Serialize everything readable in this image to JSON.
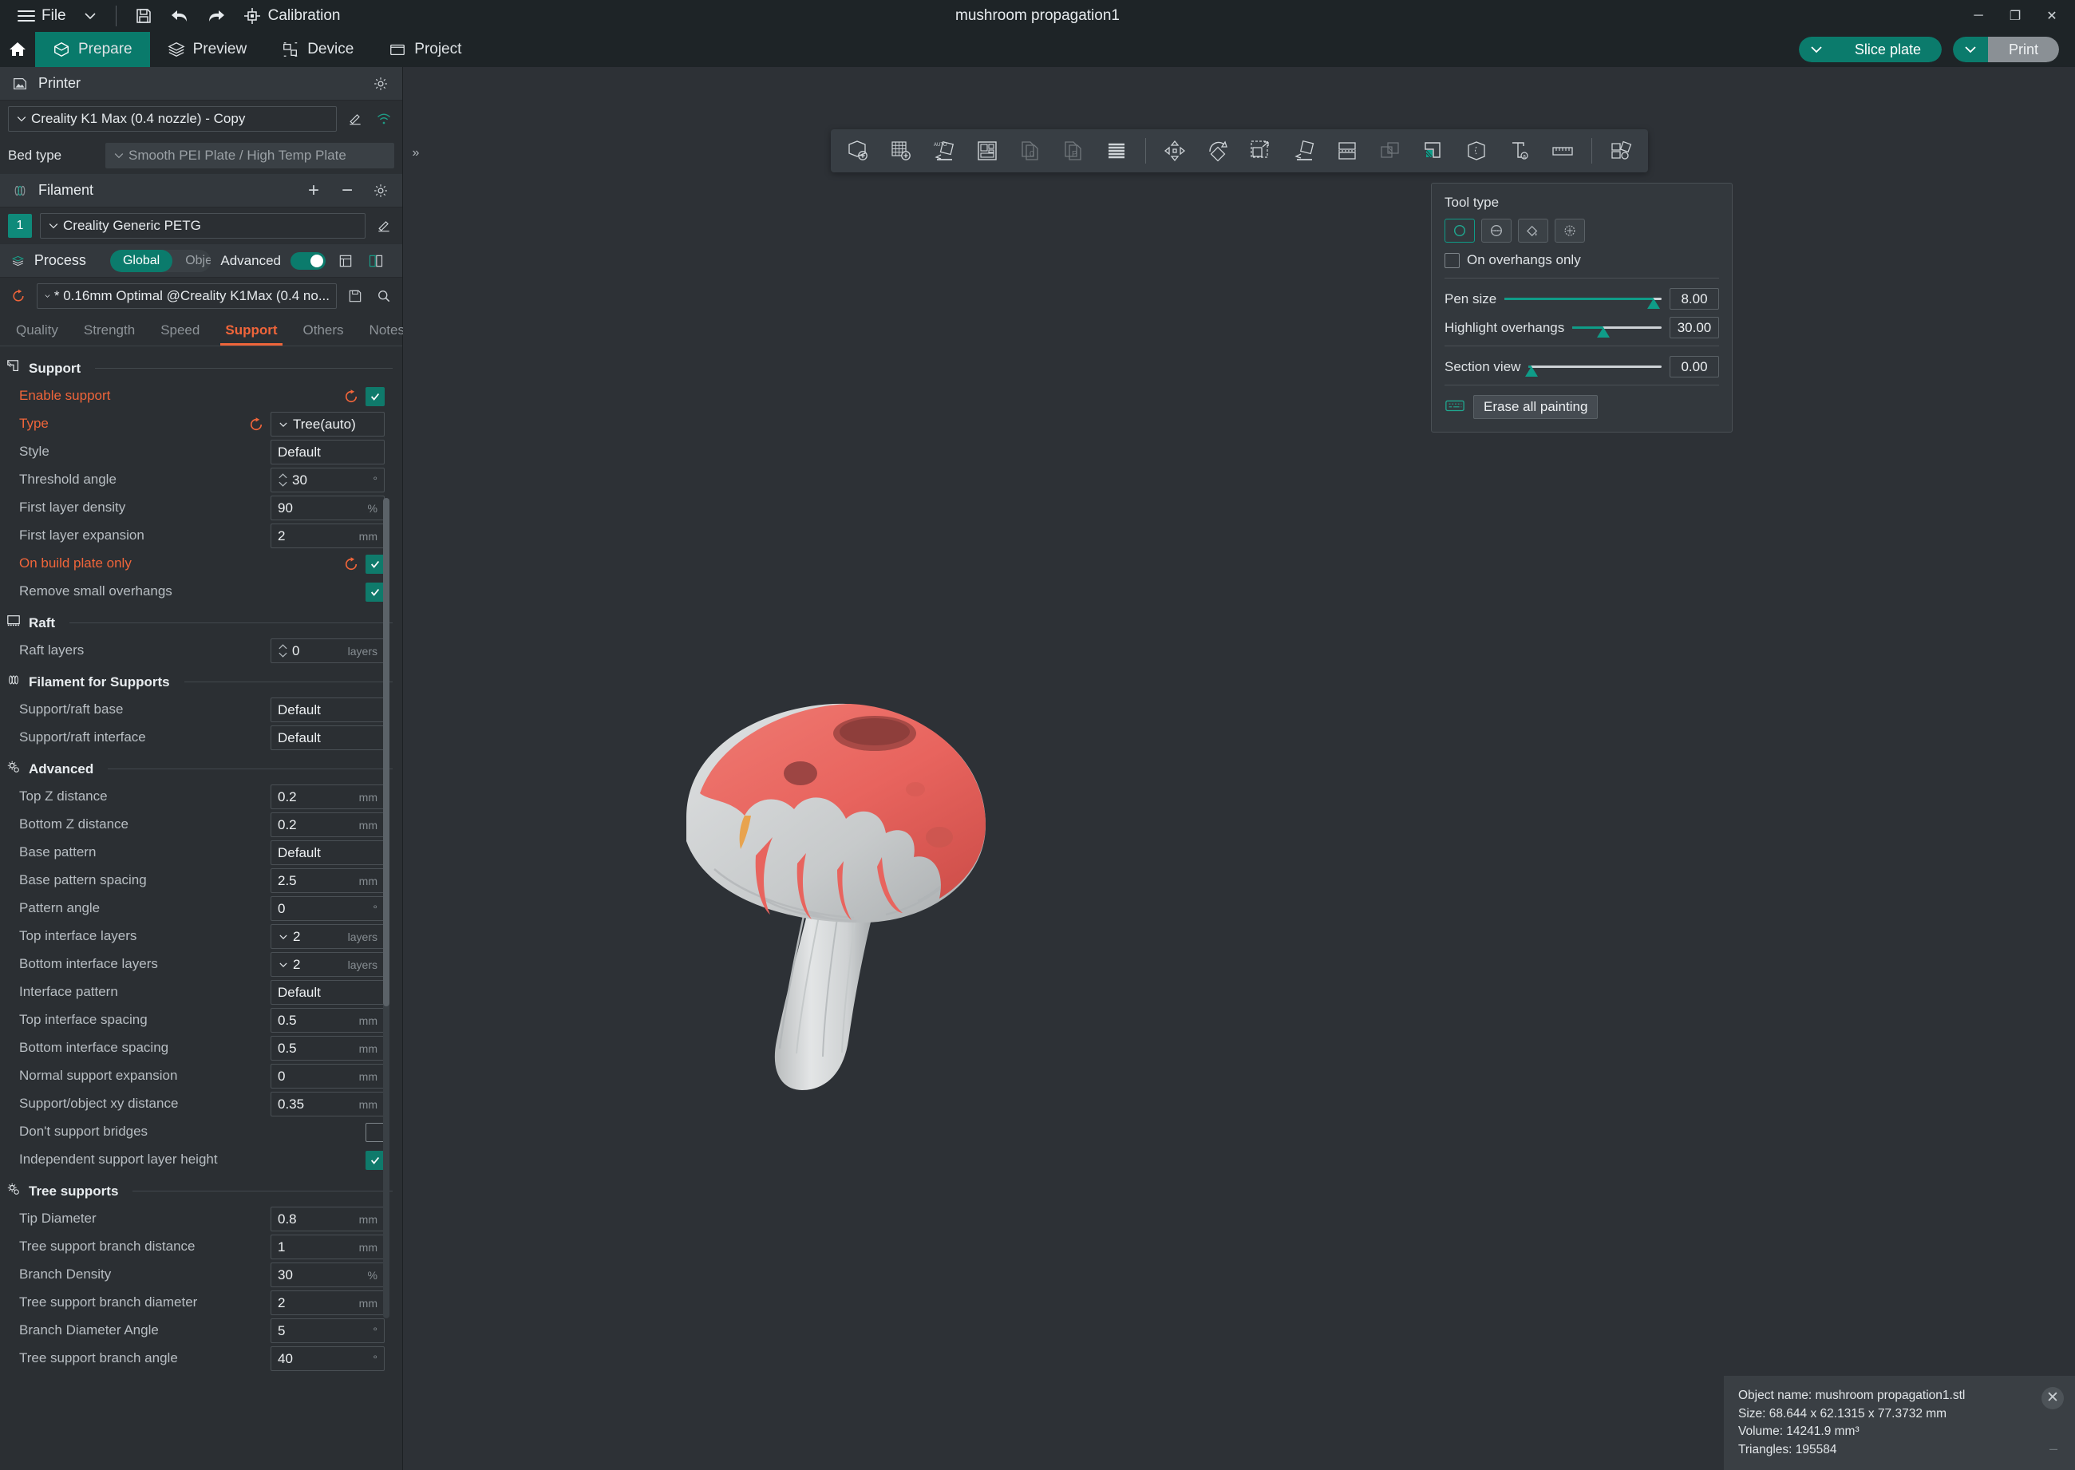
{
  "titlebar": {
    "file_label": "File",
    "calibration_label": "Calibration",
    "window_title": "mushroom propagation1",
    "minimize": "─",
    "maximize": "❐",
    "close": "✕"
  },
  "nav": {
    "tabs": [
      {
        "label": "Prepare",
        "icon": "cube-icon",
        "active": true
      },
      {
        "label": "Preview",
        "icon": "layers-icon",
        "active": false
      },
      {
        "label": "Device",
        "icon": "device-icon",
        "active": false
      },
      {
        "label": "Project",
        "icon": "project-icon",
        "active": false
      }
    ],
    "slice_label": "Slice plate",
    "print_label": "Print"
  },
  "printer": {
    "section_label": "Printer",
    "preset": "Creality K1 Max (0.4 nozzle) - Copy",
    "bed_type_label": "Bed type",
    "bed_type_value": "Smooth PEI Plate / High Temp Plate"
  },
  "filament": {
    "section_label": "Filament",
    "index": "1",
    "preset": "Creality Generic PETG",
    "add": "+",
    "remove": "−"
  },
  "process": {
    "section_label": "Process",
    "global_label": "Global",
    "objects_label": "Objects",
    "advanced_label": "Advanced",
    "preset": "* 0.16mm Optimal @Creality K1Max (0.4 no...",
    "tabs": [
      {
        "label": "Quality",
        "active": false
      },
      {
        "label": "Strength",
        "active": false
      },
      {
        "label": "Speed",
        "active": false
      },
      {
        "label": "Support",
        "active": true
      },
      {
        "label": "Others",
        "active": false
      },
      {
        "label": "Notes",
        "active": false
      }
    ]
  },
  "settings": {
    "sections": [
      {
        "title": "Support",
        "icon": "support-icon",
        "rows": [
          {
            "name": "Enable support",
            "highlight": true,
            "reset": true,
            "type": "check",
            "checked": true
          },
          {
            "name": "Type",
            "highlight": true,
            "reset": true,
            "type": "combo",
            "value": "Tree(auto)"
          },
          {
            "name": "Style",
            "type": "text",
            "value": "Default"
          },
          {
            "name": "Threshold angle",
            "type": "spin",
            "value": "30",
            "unit": "°"
          },
          {
            "name": "First layer density",
            "type": "text",
            "value": "90",
            "unit": "%"
          },
          {
            "name": "First layer expansion",
            "type": "text",
            "value": "2",
            "unit": "mm"
          },
          {
            "name": "On build plate only",
            "highlight": true,
            "reset": true,
            "type": "check",
            "checked": true
          },
          {
            "name": "Remove small overhangs",
            "type": "check",
            "checked": true
          }
        ]
      },
      {
        "title": "Raft",
        "icon": "raft-icon",
        "rows": [
          {
            "name": "Raft layers",
            "type": "spin",
            "value": "0",
            "unit": "layers"
          }
        ]
      },
      {
        "title": "Filament for Supports",
        "icon": "filament-icon",
        "rows": [
          {
            "name": "Support/raft base",
            "type": "text",
            "value": "Default"
          },
          {
            "name": "Support/raft interface",
            "type": "text",
            "value": "Default"
          }
        ]
      },
      {
        "title": "Advanced",
        "icon": "gear-icon",
        "rows": [
          {
            "name": "Top Z distance",
            "type": "text",
            "value": "0.2",
            "unit": "mm"
          },
          {
            "name": "Bottom Z distance",
            "type": "text",
            "value": "0.2",
            "unit": "mm"
          },
          {
            "name": "Base pattern",
            "type": "text",
            "value": "Default"
          },
          {
            "name": "Base pattern spacing",
            "type": "text",
            "value": "2.5",
            "unit": "mm"
          },
          {
            "name": "Pattern angle",
            "type": "text",
            "value": "0",
            "unit": "°"
          },
          {
            "name": "Top interface layers",
            "type": "combo-num",
            "value": "2",
            "unit": "layers"
          },
          {
            "name": "Bottom interface layers",
            "type": "combo-num",
            "value": "2",
            "unit": "layers"
          },
          {
            "name": "Interface pattern",
            "type": "text",
            "value": "Default"
          },
          {
            "name": "Top interface spacing",
            "type": "text",
            "value": "0.5",
            "unit": "mm"
          },
          {
            "name": "Bottom interface spacing",
            "type": "text",
            "value": "0.5",
            "unit": "mm"
          },
          {
            "name": "Normal support expansion",
            "type": "text",
            "value": "0",
            "unit": "mm"
          },
          {
            "name": "Support/object xy distance",
            "type": "text",
            "value": "0.35",
            "unit": "mm"
          },
          {
            "name": "Don't support bridges",
            "type": "check",
            "checked": false
          },
          {
            "name": "Independent support layer height",
            "type": "check",
            "checked": true
          }
        ]
      },
      {
        "title": "Tree supports",
        "icon": "gear-icon",
        "rows": [
          {
            "name": "Tip Diameter",
            "type": "text",
            "value": "0.8",
            "unit": "mm"
          },
          {
            "name": "Tree support branch distance",
            "type": "text",
            "value": "1",
            "unit": "mm"
          },
          {
            "name": "Branch Density",
            "type": "text",
            "value": "30",
            "unit": "%"
          },
          {
            "name": "Tree support branch diameter",
            "type": "text",
            "value": "2",
            "unit": "mm"
          },
          {
            "name": "Branch Diameter Angle",
            "type": "text",
            "value": "5",
            "unit": "°"
          },
          {
            "name": "Tree support branch angle",
            "type": "text",
            "value": "40",
            "unit": "°"
          }
        ]
      }
    ]
  },
  "viewport_toolbar": {
    "items": [
      {
        "name": "add-object-icon",
        "dim": false
      },
      {
        "name": "add-plate-icon",
        "dim": false
      },
      {
        "name": "auto-orient-icon",
        "dim": false
      },
      {
        "name": "arrange-icon",
        "dim": false
      },
      {
        "name": "copy-object-icon",
        "dim": true
      },
      {
        "name": "paste-object-icon",
        "dim": true
      },
      {
        "name": "layers-icon",
        "dim": false
      },
      {
        "name": "move-icon",
        "dim": false
      },
      {
        "name": "rotate-icon",
        "dim": false
      },
      {
        "name": "scale-icon",
        "dim": false
      },
      {
        "name": "lay-flat-icon",
        "dim": false
      },
      {
        "name": "cut-icon",
        "dim": false
      },
      {
        "name": "paint-seam-icon",
        "dim": true
      },
      {
        "name": "support-painting-icon",
        "dim": false,
        "selected": true
      },
      {
        "name": "color-painting-icon",
        "dim": false
      },
      {
        "name": "text-icon",
        "dim": false
      },
      {
        "name": "measure-icon",
        "dim": false
      },
      {
        "name": "assembly-icon",
        "dim": false
      }
    ]
  },
  "tool_panel": {
    "title": "Tool type",
    "tools": [
      {
        "name": "circle-brush-icon",
        "active": true
      },
      {
        "name": "sphere-brush-icon",
        "active": false
      },
      {
        "name": "fill-bucket-icon",
        "active": false
      },
      {
        "name": "smart-fill-icon",
        "active": false
      }
    ],
    "on_overhangs_label": "On overhangs only",
    "on_overhangs_checked": false,
    "sliders": [
      {
        "label": "Pen size",
        "value": "8.00",
        "percent": 95
      },
      {
        "label": "Highlight overhangs",
        "value": "30.00",
        "percent": 35
      },
      {
        "label": "Section view",
        "value": "0.00",
        "percent": 2
      }
    ],
    "keyboard_icon": "keyboard-icon",
    "erase_label": "Erase all painting"
  },
  "object_info": {
    "name_line": "Object name: mushroom propagation1.stl",
    "size_line": "Size: 68.644 x 62.1315 x 77.3732 mm",
    "volume_line": "Volume: 14241.9 mm³",
    "triangles_line": "Triangles: 195584",
    "close_icon": "close-icon",
    "minimize_icon": "minimize-icon"
  },
  "colors": {
    "accent": "#0b7b6c",
    "highlight": "#f0653a",
    "paint_red": "#e8645e",
    "model_grey": "#d6d6d6"
  }
}
